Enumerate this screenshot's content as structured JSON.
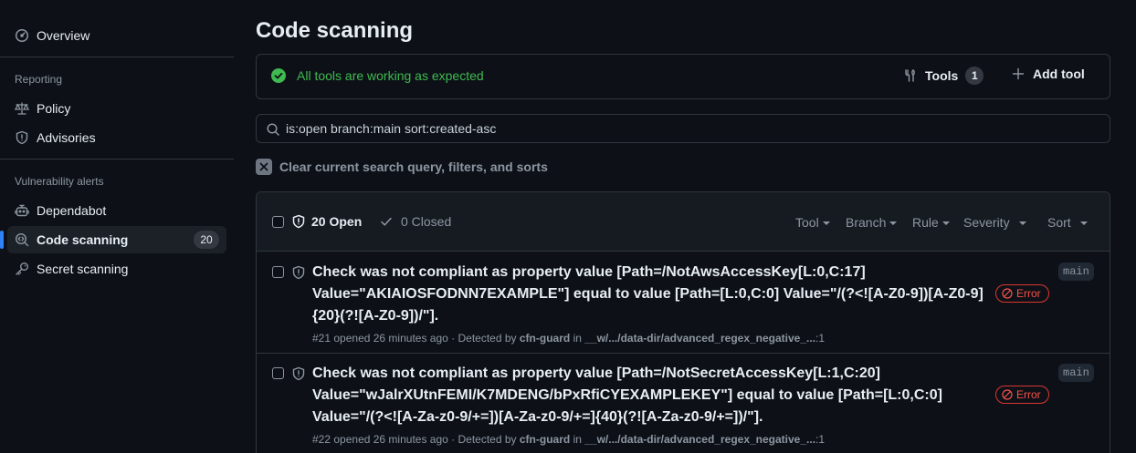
{
  "sidebar": {
    "overview": "Overview",
    "reporting_heading": "Reporting",
    "policy": "Policy",
    "advisories": "Advisories",
    "vuln_heading": "Vulnerability alerts",
    "dependabot": "Dependabot",
    "code_scanning": "Code scanning",
    "code_scanning_count": "20",
    "secret_scanning": "Secret scanning"
  },
  "page": {
    "title": "Code scanning"
  },
  "tools": {
    "status": "All tools are working as expected",
    "tools_label": "Tools",
    "tools_count": "1",
    "add_tool_label": "Add tool"
  },
  "search": {
    "query": "is:open branch:main sort:created-asc"
  },
  "clear": {
    "label": "Clear current search query, filters, and sorts"
  },
  "alerts_header": {
    "open_label": "20 Open",
    "closed_label": "0 Closed",
    "filters": [
      "Tool",
      "Branch",
      "Rule",
      "Severity",
      "Sort"
    ]
  },
  "alerts": [
    {
      "title": "Check was not compliant as property value [Path=/NotAwsAccessKey[L:0,C:17] Value=\"AKIAIOSFODNN7EXAMPLE\"] equal to value [Path=[L:0,C:0] Value=\"/(?<![A-Z0-9])[A-Z0-9]{20}(?![A-Z0-9])/\"].",
      "number": "#21",
      "opened": "opened 26 minutes ago",
      "detected_prefix": "Detected by",
      "tool": "cfn-guard",
      "in_label": "in",
      "path": "__w/.../data-dir/advanced_regex_negative_...",
      "line": ":1",
      "severity": "Error",
      "branch": "main"
    },
    {
      "title": "Check was not compliant as property value [Path=/NotSecretAccessKey[L:1,C:20] Value=\"wJalrXUtnFEMI/K7MDENG/bPxRfiCYEXAMPLEKEY\"] equal to value [Path=[L:0,C:0] Value=\"/(?<![A-Za-z0-9/+=])[A-Za-z0-9/+=]{40}(?![A-Za-z0-9/+=])/\"].",
      "number": "#22",
      "opened": "opened 26 minutes ago",
      "detected_prefix": "Detected by",
      "tool": "cfn-guard",
      "in_label": "in",
      "path": "__w/.../data-dir/advanced_regex_negative_...",
      "line": ":1",
      "severity": "Error",
      "branch": "main"
    }
  ],
  "colors": {
    "background": "#0d1117",
    "border": "#30363d",
    "success": "#3fb950",
    "danger": "#f85149",
    "accent": "#2f81f7",
    "muted": "#8d96a0"
  }
}
